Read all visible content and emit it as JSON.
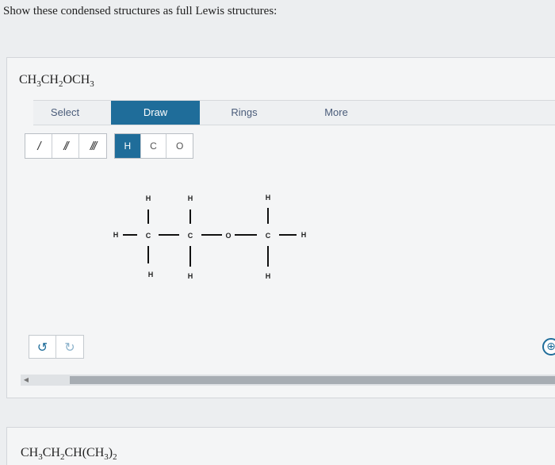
{
  "question": "Show these condensed structures as full Lewis structures:",
  "formula1": {
    "parts": [
      "CH",
      "3",
      "CH",
      "2",
      "OCH",
      "3"
    ]
  },
  "formula2": {
    "parts": [
      "CH",
      "3",
      "CH",
      "2",
      "CH(CH",
      "3",
      ")",
      "2"
    ]
  },
  "toolbar": {
    "tabs": [
      "Select",
      "Draw",
      "Rings",
      "More"
    ],
    "active_tab": "Draw"
  },
  "bond_tools": [
    "/",
    "//",
    "///"
  ],
  "atom_tools": [
    "H",
    "C",
    "O"
  ],
  "active_atom": "H",
  "undo": {
    "undo_icon": "undo-icon",
    "redo_icon": "redo-icon",
    "undo_glyph": "↺",
    "redo_glyph": "↻"
  },
  "zoom_glyph": "⊕",
  "scroll_left_glyph": "◀",
  "molecule": {
    "atoms": [
      {
        "id": "h1",
        "label": "H"
      },
      {
        "id": "c1",
        "label": "C"
      },
      {
        "id": "h2",
        "label": "H"
      },
      {
        "id": "h3",
        "label": "H"
      },
      {
        "id": "c2",
        "label": "C"
      },
      {
        "id": "h4",
        "label": "H"
      },
      {
        "id": "h5",
        "label": "H"
      },
      {
        "id": "o1",
        "label": "O"
      },
      {
        "id": "c3",
        "label": "C"
      },
      {
        "id": "h6",
        "label": "H"
      },
      {
        "id": "h7",
        "label": "H"
      },
      {
        "id": "h8",
        "label": "H"
      }
    ]
  }
}
